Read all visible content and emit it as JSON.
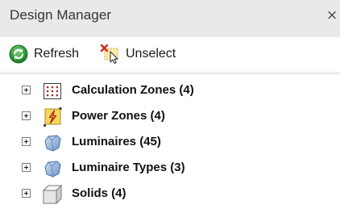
{
  "panel": {
    "title": "Design Manager",
    "close_glyph": "×"
  },
  "toolbar": {
    "refresh_label": "Refresh",
    "refresh_icon": "refresh-icon",
    "unselect_label": "Unselect",
    "unselect_icon": "unselect-icon"
  },
  "tree": {
    "items": [
      {
        "label": "Calculation Zones (4)",
        "icon": "calculation-zones-icon"
      },
      {
        "label": "Power Zones (4)",
        "icon": "power-zones-icon"
      },
      {
        "label": "Luminaires (45)",
        "icon": "luminaire-icon"
      },
      {
        "label": "Luminaire Types (3)",
        "icon": "luminaire-type-icon"
      },
      {
        "label": "Solids (4)",
        "icon": "solid-icon"
      }
    ]
  },
  "colors": {
    "titlebar_bg": "#e9e9e9",
    "refresh_green": "#2f9a3a",
    "calc_zone_dot": "#b0201b",
    "power_zone_yellow": "#f4d65a",
    "luminaire_blue": "#7fa7d9"
  }
}
